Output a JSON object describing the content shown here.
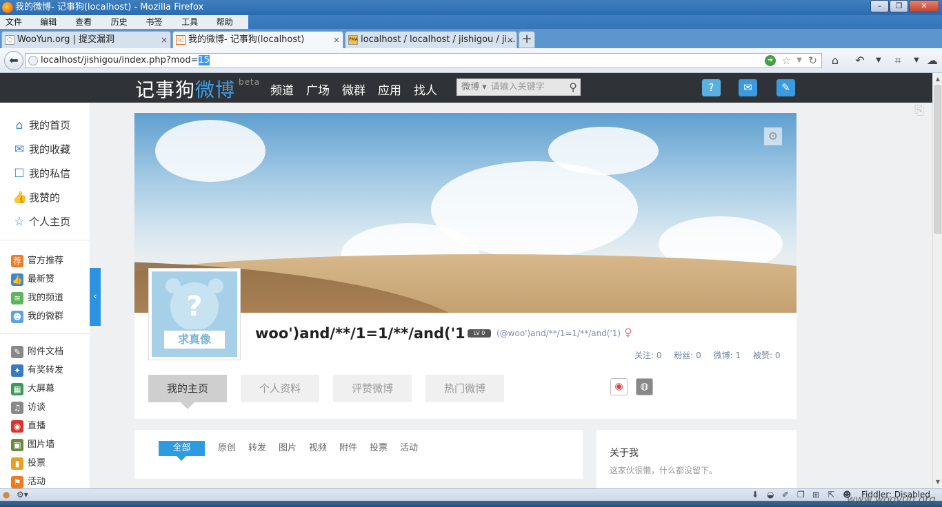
{
  "window": {
    "title": "我的微博- 记事狗(localhost) - Mozilla Firefox"
  },
  "menu": [
    "文件(F)",
    "编辑(E)",
    "查看(V)",
    "历史(S)",
    "书签(B)",
    "工具(T)",
    "帮助(H)"
  ],
  "tabs": [
    {
      "label": "WooYun.org | 提交漏洞",
      "icon": "◌"
    },
    {
      "label": "我的微博- 记事狗(localhost)",
      "icon": "记"
    },
    {
      "label": "localhost / localhost / jishigou / ji...",
      "icon": "PMA"
    }
  ],
  "newtab": "+",
  "url": {
    "prefix": "localhost/jishigou/index.php?mod=",
    "selected": "15"
  },
  "site": {
    "logo_main": "记事狗",
    "logo_accent": "微博",
    "logo_beta": "beta",
    "nav": [
      "频道",
      "广场",
      "微群",
      "应用",
      "找人"
    ],
    "search_scope": "微博 ▾",
    "search_placeholder": "请输入关键字"
  },
  "sidebar": {
    "main": [
      {
        "label": "我的首页",
        "icon": "⌂"
      },
      {
        "label": "我的收藏",
        "icon": "✉"
      },
      {
        "label": "我的私信",
        "icon": "☐"
      },
      {
        "label": "我赞的",
        "icon": "👍"
      },
      {
        "label": "个人主页",
        "icon": "☆"
      }
    ],
    "group1": [
      {
        "label": "官方推荐",
        "icon": "荐",
        "color": "#f07a24"
      },
      {
        "label": "最新赞",
        "icon": "👍",
        "color": "#3a8ad2"
      },
      {
        "label": "我的频道",
        "icon": "≋",
        "color": "#5bb55b"
      },
      {
        "label": "我的微群",
        "icon": "☻",
        "color": "#5aa3dc"
      }
    ],
    "group2": [
      {
        "label": "附件文档",
        "icon": "✎",
        "color": "#888888"
      },
      {
        "label": "有奖转发",
        "icon": "✦",
        "color": "#3a7ac2"
      },
      {
        "label": "大屏幕",
        "icon": "▦",
        "color": "#3a9a5a"
      },
      {
        "label": "访谈",
        "icon": "♫",
        "color": "#888888"
      },
      {
        "label": "直播",
        "icon": "◉",
        "color": "#d8332a"
      },
      {
        "label": "图片墙",
        "icon": "▣",
        "color": "#6a8a3a"
      },
      {
        "label": "投票",
        "icon": "▮",
        "color": "#e8a020"
      },
      {
        "label": "活动",
        "icon": "⚑",
        "color": "#f07a24"
      }
    ]
  },
  "profile": {
    "avatar_text": "求真像",
    "avatar_mark": "?",
    "nickname": "woo')and/**/1=1/**/and('1",
    "level": "LV 0",
    "handle": "(@woo')and/**/1=1/**/and('1)",
    "gender": "♀",
    "stats": [
      "关注: 0",
      "粉丝: 0",
      "微博: 1",
      "被赞: 0"
    ],
    "tabs": [
      "我的主页",
      "个人资料",
      "评赞微博",
      "热门微博"
    ]
  },
  "feed": {
    "tabs": [
      "全部",
      "原创",
      "转发",
      "图片",
      "视频",
      "附件",
      "投票",
      "活动"
    ]
  },
  "about": {
    "title": "关于我",
    "text": "这家伙很懒，什么都没留下。"
  },
  "statusbar": {
    "fiddler": "Fiddler: Disabled"
  },
  "watermark": "www.wooyun.org",
  "colors": {
    "accent": "#2d9be0",
    "header_bg": "#2f3236",
    "link": "#6d84a0"
  }
}
